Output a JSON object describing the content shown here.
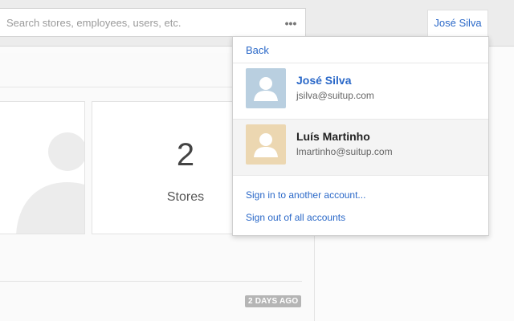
{
  "search": {
    "placeholder": "Search stores, employees, users, etc.",
    "more_icon": "more-horizontal-icon"
  },
  "header": {
    "user_name": "José Silva"
  },
  "main": {
    "stores_count": "2",
    "stores_label": "Stores",
    "badge": "2 DAYS AGO",
    "placeholder_icon": "person-silhouette-icon"
  },
  "account_menu": {
    "back_label": "Back",
    "accounts": [
      {
        "name": "José Silva",
        "email": "jsilva@suitup.com",
        "avatar_color": "#b9cfe0",
        "name_color": "#2a68c8",
        "selected": false
      },
      {
        "name": "Luís Martinho",
        "email": "lmartinho@suitup.com",
        "avatar_color": "#ecd7b1",
        "name_color": "#222222",
        "selected": true
      }
    ],
    "sign_in_label": "Sign in to another account...",
    "sign_out_label": "Sign out of all accounts"
  }
}
